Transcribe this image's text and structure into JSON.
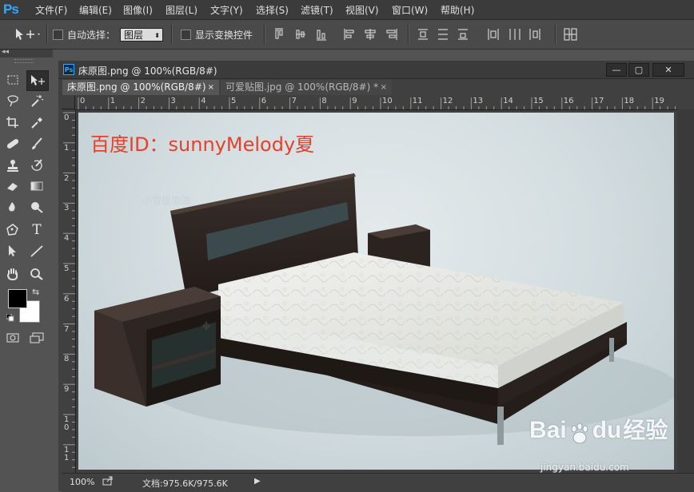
{
  "app": {
    "logo": "Ps",
    "brand_color": "#31a8ff"
  },
  "menu": [
    {
      "label": "文件(F)"
    },
    {
      "label": "编辑(E)"
    },
    {
      "label": "图像(I)"
    },
    {
      "label": "图层(L)"
    },
    {
      "label": "文字(Y)"
    },
    {
      "label": "选择(S)"
    },
    {
      "label": "滤镜(T)"
    },
    {
      "label": "视图(V)"
    },
    {
      "label": "窗口(W)"
    },
    {
      "label": "帮助(H)"
    }
  ],
  "options_bar": {
    "auto_select_label": "自动选择：",
    "auto_select_checked": false,
    "layer_select_value": "图层",
    "show_transform_label": "显示变换控件",
    "show_transform_checked": false,
    "tool_icon": "move-tool-icon"
  },
  "toolbox": {
    "foreground_color": "#000000",
    "background_color": "#ffffff",
    "tools": [
      {
        "name": "marquee-tool",
        "icon": "marquee-icon"
      },
      {
        "name": "move-tool",
        "icon": "move-icon"
      },
      {
        "name": "lasso-tool",
        "icon": "lasso-icon"
      },
      {
        "name": "magic-wand-tool",
        "icon": "magic-wand-icon"
      },
      {
        "name": "crop-tool",
        "icon": "crop-icon"
      },
      {
        "name": "eyedropper-tool",
        "icon": "eyedropper-icon"
      },
      {
        "name": "healing-brush-tool",
        "icon": "bandage-icon"
      },
      {
        "name": "brush-tool",
        "icon": "brush-icon"
      },
      {
        "name": "clone-stamp-tool",
        "icon": "stamp-icon"
      },
      {
        "name": "history-brush-tool",
        "icon": "history-brush-icon"
      },
      {
        "name": "eraser-tool",
        "icon": "eraser-icon"
      },
      {
        "name": "gradient-tool",
        "icon": "gradient-icon"
      },
      {
        "name": "blur-tool",
        "icon": "blur-icon"
      },
      {
        "name": "dodge-tool",
        "icon": "dodge-icon"
      },
      {
        "name": "pen-tool",
        "icon": "pen-icon"
      },
      {
        "name": "type-tool",
        "icon": "type-icon",
        "glyph": "T"
      },
      {
        "name": "path-selection-tool",
        "icon": "path-selection-icon"
      },
      {
        "name": "line-tool",
        "icon": "line-icon"
      },
      {
        "name": "hand-tool",
        "icon": "hand-icon"
      },
      {
        "name": "zoom-tool",
        "icon": "zoom-icon"
      }
    ]
  },
  "document_window": {
    "title": "床原图.png @ 100%(RGB/8#)",
    "tabs": [
      {
        "label": "床原图.png @ 100%(RGB/8#)",
        "close": "×",
        "active": true
      },
      {
        "label": "可爱贴图.jpg @ 100%(RGB/8#) *",
        "close": "×",
        "active": false
      }
    ],
    "ruler_top": [
      "0",
      "1",
      "2",
      "3",
      "4",
      "5",
      "6",
      "7",
      "8",
      "9",
      "10",
      "11",
      "12",
      "13",
      "14",
      "15",
      "16",
      "17",
      "18",
      "19"
    ],
    "ruler_left": [
      "0",
      "1",
      "2",
      "3",
      "4",
      "5",
      "6",
      "7",
      "8",
      "9",
      "1\n0",
      "1\n1"
    ]
  },
  "canvas": {
    "overlay_text": "百度ID：sunnyMelody夏",
    "overlay_color": "#e8402a",
    "faint_text": "小雪怪加油",
    "baidu_logo_text": "Bai",
    "baidu_logo_suffix": "du",
    "baidu_logo_cn": "经验",
    "baidu_url": "jingyan.baidu.com"
  },
  "status_bar": {
    "zoom": "100%",
    "doc_size": "文档:975.6K/975.6K"
  }
}
